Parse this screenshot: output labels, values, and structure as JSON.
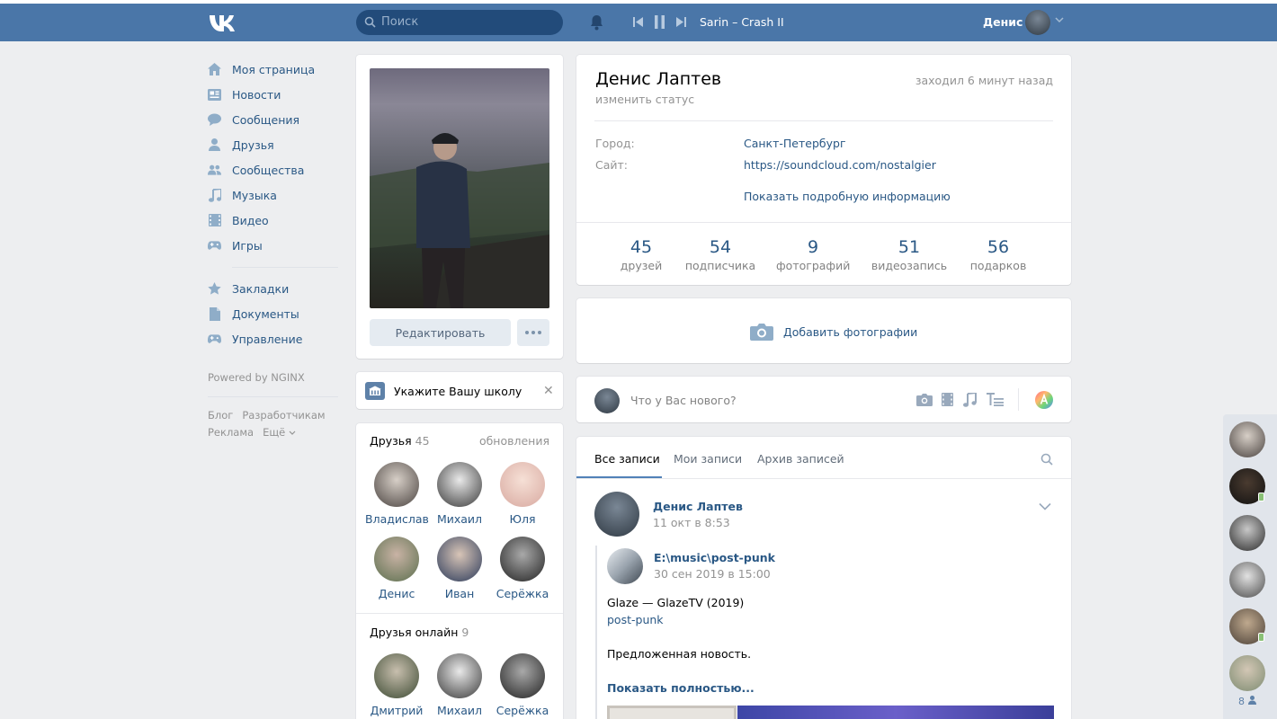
{
  "header": {
    "search_placeholder": "Поиск",
    "track": "Sarin – Crash II",
    "user_name": "Денис",
    "brand_color": "#4a76a8"
  },
  "sidenav": {
    "items": [
      {
        "label": "Моя страница",
        "icon": "home-icon"
      },
      {
        "label": "Новости",
        "icon": "news-icon"
      },
      {
        "label": "Сообщения",
        "icon": "messages-icon"
      },
      {
        "label": "Друзья",
        "icon": "friend-icon"
      },
      {
        "label": "Сообщества",
        "icon": "communities-icon"
      },
      {
        "label": "Музыка",
        "icon": "music-icon"
      },
      {
        "label": "Видео",
        "icon": "video-icon"
      },
      {
        "label": "Игры",
        "icon": "games-icon"
      }
    ],
    "items2": [
      {
        "label": "Закладки",
        "icon": "star-icon"
      },
      {
        "label": "Документы",
        "icon": "document-icon"
      },
      {
        "label": "Управление",
        "icon": "games-icon"
      }
    ],
    "powered": "Powered by NGINX",
    "footer": [
      "Блог",
      "Разработчикам",
      "Реклама",
      "Ещё"
    ]
  },
  "profile_left": {
    "edit_button": "Редактировать",
    "school_prompt": "Укажите Вашу школу",
    "friends_title": "Друзья",
    "friends_count": "45",
    "friends_updates": "обновления",
    "friends": [
      "Владислав",
      "Михаил",
      "Юля",
      "Денис",
      "Иван",
      "Серёжка"
    ],
    "online_title": "Друзья онлайн",
    "online_count": "9",
    "online": [
      "Дмитрий",
      "Михаил",
      "Серёжка"
    ]
  },
  "profile": {
    "name": "Денис Лаптев",
    "status": "изменить статус",
    "last_seen": "заходил 6 минут назад",
    "city_label": "Город:",
    "city": "Санкт-Петербург",
    "site_label": "Сайт:",
    "site": "https://soundcloud.com/nostalgier",
    "more_info": "Показать подробную информацию",
    "stats": [
      {
        "num": "45",
        "label": "друзей"
      },
      {
        "num": "54",
        "label": "подписчика"
      },
      {
        "num": "9",
        "label": "фотографий"
      },
      {
        "num": "51",
        "label": "видеозапись"
      },
      {
        "num": "56",
        "label": "подарков"
      }
    ]
  },
  "add_photos": "Добавить фотографии",
  "postbox": {
    "placeholder": "Что у Вас нового?"
  },
  "wall": {
    "tabs": [
      "Все записи",
      "Мои записи",
      "Архив записей"
    ],
    "post": {
      "author": "Денис Лаптев",
      "date": "11 окт в 8:53",
      "repost_author": "E:\\music\\post-punk",
      "repost_date": "30 сен 2019 в 15:00",
      "line1": "Glaze — GlazeTV (2019)",
      "line2": "post-punk",
      "line3": "Предложенная новость.",
      "show_more": "Показать полностью..."
    }
  },
  "rightbar": {
    "count": "8"
  }
}
